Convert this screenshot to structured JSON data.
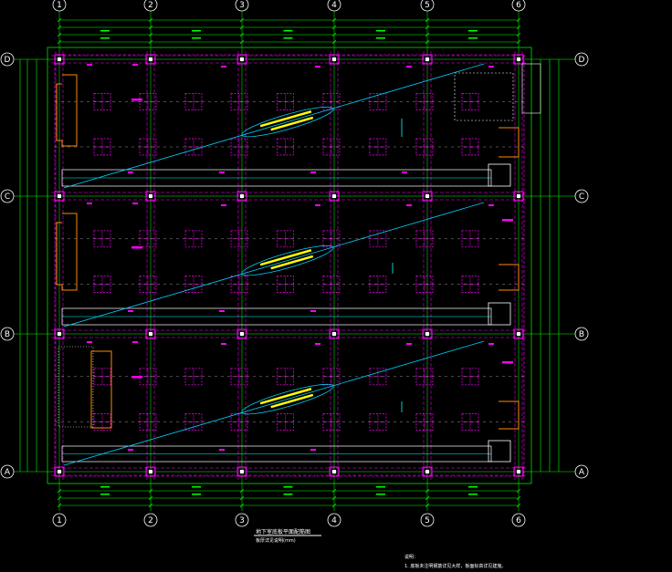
{
  "colors": {
    "background": "#000000",
    "dimension": "#00ff00",
    "column": "#ff00ff",
    "axis_circle": "#ffffff",
    "beam": "#00ffff",
    "slope_line": "#00d0ff",
    "wall": "#ff8800",
    "label": "#ffff00",
    "note": "#ffffff"
  },
  "axes": {
    "columns": [
      "1",
      "2",
      "3",
      "4",
      "5",
      "6"
    ],
    "rows": [
      "D",
      "C",
      "B",
      "A"
    ]
  },
  "plan": {
    "title": "地下室底板平面配筋图",
    "subtitle": "板厚详见说明(mm)"
  },
  "notes": {
    "heading": "说明：",
    "line1": "1. 底板未注明钢筋详见大样，板面标高详见建施。"
  },
  "icons": {
    "axis_bubble": "axis-bubble-icon",
    "column_mark": "column-square-icon"
  }
}
